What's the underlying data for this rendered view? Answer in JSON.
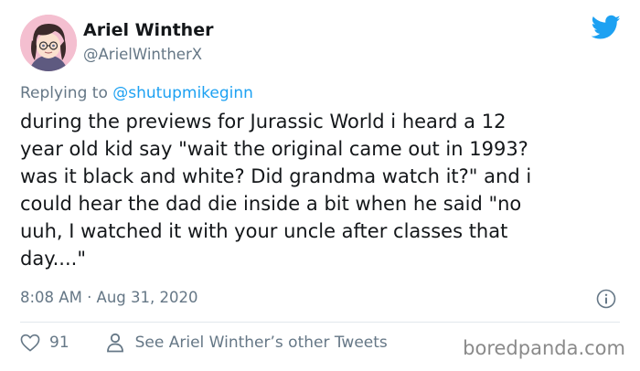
{
  "author": {
    "name": "Ariel Winther",
    "handle": "@ArielWintherX",
    "avatar_icon": "cartoon-avatar"
  },
  "reply": {
    "prefix": "Replying to",
    "mention": "@shutupmikeginn"
  },
  "tweet_text": "during the previews for Jurassic World i heard a 12\nyear old kid say \"wait the original came out in 1993?\nwas it black and white? Did grandma watch it?\" and i\ncould hear the dad die inside a bit when he said \"no\nuuh, I watched it with your uncle after classes that\nday....\"",
  "timestamp": "8:08 AM · Aug 31, 2020",
  "actions": {
    "likes": "91",
    "like_icon": "heart-icon",
    "profile_icon": "person-icon",
    "profile_link": "See Ariel Winther’s other Tweets"
  },
  "watermark": "boredpanda.com",
  "colors": {
    "twitter_blue": "#1da1f2",
    "secondary_text": "#657786",
    "primary_text": "#14171a"
  }
}
